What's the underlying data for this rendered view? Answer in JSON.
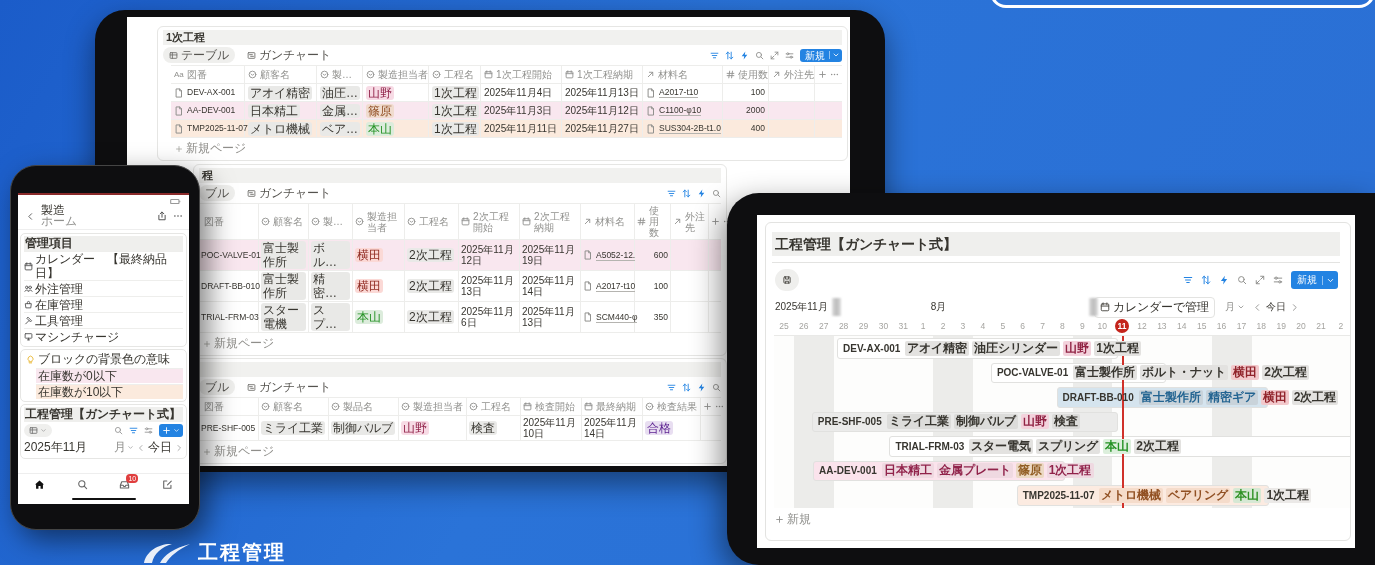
{
  "tablet": {
    "blocks": [
      {
        "title": "1次工程",
        "tabs": [
          {
            "label": "テーブル",
            "kind": "table",
            "selected": true
          },
          {
            "label": "ガンチャート",
            "kind": "gantt",
            "selected": false
          }
        ],
        "toolbar": [
          {
            "kind": "filter",
            "active": true
          },
          {
            "kind": "sort",
            "active": true
          },
          {
            "kind": "bolt",
            "active": true
          },
          {
            "kind": "search",
            "active": false
          },
          {
            "kind": "expand",
            "active": false
          },
          {
            "kind": "sliders",
            "active": false
          }
        ],
        "new_button": "新規",
        "columns": [
          {
            "label": "図番",
            "kind": "title",
            "prefix": "Aa"
          },
          {
            "label": "顧客名",
            "kind": "select"
          },
          {
            "label": "製…",
            "kind": "select"
          },
          {
            "label": "製造担当者",
            "kind": "select"
          },
          {
            "label": "工程名",
            "kind": "select"
          },
          {
            "label": "1次工程開始",
            "kind": "date"
          },
          {
            "label": "1次工程納期",
            "kind": "date"
          },
          {
            "label": "材料名",
            "kind": "relation"
          },
          {
            "label": "使用数",
            "kind": "number"
          },
          {
            "label": "外注先",
            "kind": "relation"
          }
        ],
        "rows": [
          {
            "color": "#ffffff",
            "cells": [
              {
                "text": "DEV-AX-001"
              },
              {
                "text": "アオイ精密",
                "color": "#e9e9e7"
              },
              {
                "text": "油圧…",
                "color": "#e9e9e7"
              },
              {
                "text": "山野",
                "color": "#f7dbe5"
              },
              {
                "text": "1次工程",
                "color": "#e9e9e7"
              },
              {
                "text": "2025年11月4日"
              },
              {
                "text": "2025年11月13日"
              },
              {
                "text": "A2017-t10"
              },
              {
                "text": "100"
              }
            ]
          },
          {
            "color": "#f9e7ef",
            "cells": [
              {
                "text": "AA-DEV-001"
              },
              {
                "text": "日本精工",
                "color": "#e9e9e7"
              },
              {
                "text": "金属…",
                "color": "#e9e9e7"
              },
              {
                "text": "篠原",
                "color": "#f0dccf"
              },
              {
                "text": "1次工程",
                "color": "#e9e9e7"
              },
              {
                "text": "2025年11月3日"
              },
              {
                "text": "2025年11月12日"
              },
              {
                "text": "C1100-φ10"
              },
              {
                "text": "2000"
              }
            ]
          },
          {
            "color": "#fbeadd",
            "cells": [
              {
                "text": "TMP2025-11-07"
              },
              {
                "text": "メトロ機械",
                "color": "#e9e9e7"
              },
              {
                "text": "ベア…",
                "color": "#e9e9e7"
              },
              {
                "text": "本山",
                "color": "#dcecdc"
              },
              {
                "text": "1次工程",
                "color": "#e9e9e7"
              },
              {
                "text": "2025年11月11日"
              },
              {
                "text": "2025年11月27日"
              },
              {
                "text": "SUS304-2B-t1.0"
              },
              {
                "text": "400"
              }
            ]
          }
        ],
        "add_row": "新規ページ"
      },
      {
        "title": "程",
        "tabs": [
          {
            "label": "ブル",
            "selected": true
          },
          {
            "label": "ガンチャート",
            "kind": "gantt",
            "selected": false
          }
        ],
        "toolbar": [
          {
            "kind": "filter",
            "active": true
          },
          {
            "kind": "sort",
            "active": true
          },
          {
            "kind": "bolt",
            "active": true
          },
          {
            "kind": "search",
            "active": false
          }
        ],
        "columns": [
          {
            "label": "図番",
            "kind": "text"
          },
          {
            "label": "顧客名",
            "kind": "select"
          },
          {
            "label": "製…",
            "kind": "select"
          },
          {
            "label": "製造担当者",
            "kind": "select"
          },
          {
            "label": "工程名",
            "kind": "select"
          },
          {
            "label": "2次工程開始",
            "kind": "date"
          },
          {
            "label": "2次工程納期",
            "kind": "date"
          },
          {
            "label": "材料名",
            "kind": "relation"
          },
          {
            "label": "使用数",
            "kind": "number"
          },
          {
            "label": "外注先",
            "kind": "relation"
          }
        ],
        "rows": [
          {
            "color": "#f9e7ef",
            "cells": [
              {
                "text": "POC-VALVE-01"
              },
              {
                "text": "富士製作所",
                "color": "#e9e9e7"
              },
              {
                "text": "ボル…",
                "color": "#e9e9e7"
              },
              {
                "text": "横田",
                "color": "#fbd9d6"
              },
              {
                "text": "2次工程",
                "color": "#e9e9e7"
              },
              {
                "text": "2025年11月12日"
              },
              {
                "text": "2025年11月19日"
              },
              {
                "text": "A5052-12."
              },
              {
                "text": "600"
              }
            ]
          },
          {
            "color": "#ffffff",
            "cells": [
              {
                "text": "DRAFT-BB-010"
              },
              {
                "text": "富士製作所",
                "color": "#e9e9e7"
              },
              {
                "text": "精密…",
                "color": "#e9e9e7"
              },
              {
                "text": "横田",
                "color": "#fbd9d6"
              },
              {
                "text": "2次工程",
                "color": "#e9e9e7"
              },
              {
                "text": "2025年11月13日"
              },
              {
                "text": "2025年11月14日"
              },
              {
                "text": "A2017-t10"
              },
              {
                "text": "100"
              }
            ]
          },
          {
            "color": "#ffffff",
            "cells": [
              {
                "text": "TRIAL-FRM-03"
              },
              {
                "text": "スター電機",
                "color": "#e9e9e7"
              },
              {
                "text": "スプ…",
                "color": "#e9e9e7"
              },
              {
                "text": "本山",
                "color": "#dcecdc"
              },
              {
                "text": "2次工程",
                "color": "#e9e9e7"
              },
              {
                "text": "2025年11月6日"
              },
              {
                "text": "2025年11月13日"
              },
              {
                "text": "SCM440-φ"
              },
              {
                "text": "350"
              }
            ]
          }
        ],
        "add_row": "新規ページ"
      },
      {
        "tabs": [
          {
            "label": "ブル",
            "selected": true
          },
          {
            "label": "ガンチャート",
            "kind": "gantt",
            "selected": false
          }
        ],
        "toolbar": [
          {
            "kind": "filter",
            "active": true
          },
          {
            "kind": "sort",
            "active": true
          },
          {
            "kind": "bolt",
            "active": true
          },
          {
            "kind": "search",
            "active": false
          }
        ],
        "columns": [
          {
            "label": "図番",
            "kind": "text"
          },
          {
            "label": "顧客名",
            "kind": "select"
          },
          {
            "label": "製品名",
            "kind": "select"
          },
          {
            "label": "製造担当者",
            "kind": "select"
          },
          {
            "label": "工程名",
            "kind": "select"
          },
          {
            "label": "検査開始",
            "kind": "date"
          },
          {
            "label": "最終納期",
            "kind": "date"
          },
          {
            "label": "検査結果",
            "kind": "select"
          }
        ],
        "rows": [
          {
            "color": "#ffffff",
            "cells": [
              {
                "text": "PRE-SHF-005"
              },
              {
                "text": "ミライ工業",
                "color": "#e9e9e7"
              },
              {
                "text": "制御バルブ",
                "color": "#e9e9e7"
              },
              {
                "text": "山野",
                "color": "#f7dbe5"
              },
              {
                "text": "検査",
                "color": "#e9e9e7"
              },
              {
                "text": "2025年11月10日"
              },
              {
                "text": "2025年11月14日"
              },
              {
                "text": "合格",
                "color": "#e8def1"
              }
            ]
          }
        ],
        "add_row": "新規ページ"
      }
    ]
  },
  "phone": {
    "header": {
      "title": "製造",
      "subtitle": "ホーム"
    },
    "menu": {
      "title": "管理項目",
      "items": [
        {
          "kind": "calendar",
          "label": "カレンダー　【最終納品日】"
        },
        {
          "kind": "people",
          "label": "外注管理"
        },
        {
          "kind": "bag",
          "label": "在庫管理"
        },
        {
          "kind": "tools",
          "label": "工具管理"
        },
        {
          "kind": "machine",
          "label": "マシンチャージ"
        }
      ]
    },
    "callout": {
      "text": "ブロックの背景色の意味",
      "legend": [
        {
          "text": "在庫数が0以下",
          "color": "#f9e7ef"
        },
        {
          "text": "在庫数が10以下",
          "color": "#fbeadd"
        }
      ]
    },
    "gantt": {
      "title": "工程管理【ガンチャート式】",
      "toolbar": [
        {
          "kind": "search",
          "active": false
        },
        {
          "kind": "filter",
          "active": true
        },
        {
          "kind": "sliders",
          "active": false
        }
      ],
      "month": "2025年11月",
      "scale": "月",
      "today": "今日"
    },
    "tab_bar": [
      {
        "kind": "home",
        "selected": true
      },
      {
        "kind": "search",
        "selected": false
      },
      {
        "kind": "inbox",
        "selected": false,
        "badge": "10"
      },
      {
        "kind": "edit",
        "selected": false
      }
    ]
  },
  "gantt": {
    "title": "工程管理【ガンチャート式】",
    "toolbar": [
      {
        "kind": "filter",
        "active": true
      },
      {
        "kind": "sort",
        "active": true
      },
      {
        "kind": "bolt",
        "active": true
      },
      {
        "kind": "search",
        "active": false
      },
      {
        "kind": "expand",
        "active": false
      },
      {
        "kind": "sliders",
        "active": false
      }
    ],
    "new_button": "新規",
    "month": "2025年11月",
    "header_label": "8月",
    "calendar_button": "カレンダーで管理",
    "scale": "月",
    "today": "今日",
    "days": [
      {
        "label": "25",
        "weekend": false,
        "today": false
      },
      {
        "label": "26",
        "weekend": true,
        "today": false
      },
      {
        "label": "27",
        "weekend": true,
        "today": false
      },
      {
        "label": "28",
        "weekend": false,
        "today": false
      },
      {
        "label": "29",
        "weekend": false,
        "today": false
      },
      {
        "label": "30",
        "weekend": false,
        "today": false
      },
      {
        "label": "31",
        "weekend": false,
        "today": false
      },
      {
        "label": "1",
        "weekend": false,
        "today": false
      },
      {
        "label": "2",
        "weekend": true,
        "today": false
      },
      {
        "label": "3",
        "weekend": true,
        "today": false
      },
      {
        "label": "4",
        "weekend": false,
        "today": false
      },
      {
        "label": "5",
        "weekend": false,
        "today": false
      },
      {
        "label": "6",
        "weekend": false,
        "today": false
      },
      {
        "label": "7",
        "weekend": false,
        "today": false
      },
      {
        "label": "8",
        "weekend": false,
        "today": false
      },
      {
        "label": "9",
        "weekend": true,
        "today": false
      },
      {
        "label": "10",
        "weekend": true,
        "today": false
      },
      {
        "label": "11",
        "weekend": false,
        "today": true
      },
      {
        "label": "12",
        "weekend": false,
        "today": false
      },
      {
        "label": "13",
        "weekend": false,
        "today": false
      },
      {
        "label": "14",
        "weekend": false,
        "today": false
      },
      {
        "label": "15",
        "weekend": false,
        "today": false
      },
      {
        "label": "16",
        "weekend": true,
        "today": false
      },
      {
        "label": "17",
        "weekend": true,
        "today": false
      },
      {
        "label": "18",
        "weekend": false,
        "today": false
      },
      {
        "label": "19",
        "weekend": false,
        "today": false
      },
      {
        "label": "20",
        "weekend": false,
        "today": false
      },
      {
        "label": "21",
        "weekend": false,
        "today": false
      },
      {
        "label": "2",
        "weekend": false,
        "today": false
      }
    ],
    "bars": [
      {
        "id": "DEV-AX-001",
        "color": "#ffffff",
        "tags": [
          {
            "text": "アオイ精密",
            "color": "#e3e2e0"
          },
          {
            "text": "油圧シリンダー",
            "color": "#e3e2e0"
          },
          {
            "text": "山野",
            "color": "#f3d2dc"
          },
          {
            "text": "1次工程",
            "color": "#e3e2e0"
          }
        ]
      },
      {
        "id": "POC-VALVE-01",
        "color": "#ffffff",
        "tags": [
          {
            "text": "富士製作所",
            "color": "#e3e2e0"
          },
          {
            "text": "ボルト・ナット",
            "color": "#e3e2e0"
          },
          {
            "text": "横田",
            "color": "#f2c9cc"
          },
          {
            "text": "2次工程",
            "color": "#e3e2e0"
          }
        ]
      },
      {
        "id": "DRAFT-BB-010",
        "color": "#d5e4ee",
        "tags": [
          {
            "text": "富士製作所",
            "color": "#c9d3da"
          },
          {
            "text": "精密ギア",
            "color": "#c9d3da"
          },
          {
            "text": "横田",
            "color": "#f2c9cc"
          },
          {
            "text": "2次工程",
            "color": "#e3e2e0"
          }
        ]
      },
      {
        "id": "PRE-SHF-005",
        "color": "#ebebea",
        "tags": [
          {
            "text": "ミライ工業",
            "color": "#dcdcda"
          },
          {
            "text": "制御バルブ",
            "color": "#dcdcda"
          },
          {
            "text": "山野",
            "color": "#f3d2dc"
          },
          {
            "text": "検査",
            "color": "#dcdcda"
          }
        ]
      },
      {
        "id": "TRIAL-FRM-03",
        "color": "#ffffff",
        "tags": [
          {
            "text": "スター電気",
            "color": "#e3e2e0"
          },
          {
            "text": "スプリング",
            "color": "#e3e2e0"
          },
          {
            "text": "本山",
            "color": "#dcefdc"
          },
          {
            "text": "2次工程",
            "color": "#e3e2e0"
          }
        ]
      },
      {
        "id": "AA-DEV-001",
        "color": "#fbe3ec",
        "tags": [
          {
            "text": "日本精工",
            "color": "#efd9e1"
          },
          {
            "text": "金属プレート",
            "color": "#efd9e1"
          },
          {
            "text": "篠原",
            "color": "#ecd9c4"
          },
          {
            "text": "1次工程",
            "color": "#efd9e1"
          }
        ]
      },
      {
        "id": "TMP2025-11-07",
        "color": "#fcebe1",
        "tags": [
          {
            "text": "メトロ機械",
            "color": "#f5dccb"
          },
          {
            "text": "ベアリング",
            "color": "#f5dccb"
          },
          {
            "text": "本山",
            "color": "#d6e8d4"
          },
          {
            "text": "1次工程",
            "color": "#ebe9e7"
          }
        ]
      }
    ],
    "add": "新規"
  },
  "banner": {
    "title": "工程管理"
  }
}
